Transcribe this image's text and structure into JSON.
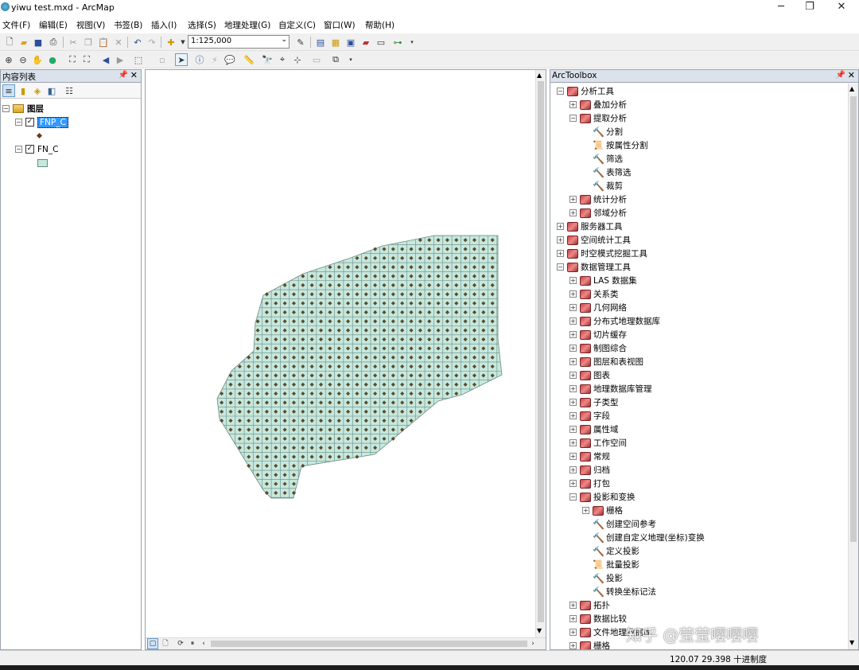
{
  "window": {
    "title": "yiwu test.mxd - ArcMap",
    "minimize": "─",
    "maximize": "❐",
    "close": "✕"
  },
  "menu": [
    "文件(F)",
    "编辑(E)",
    "视图(V)",
    "书签(B)",
    "插入(I)",
    "选择(S)",
    "地理处理(G)",
    "自定义(C)",
    "窗口(W)",
    "帮助(H)"
  ],
  "toolbar": {
    "scale": "1:125,000"
  },
  "toc": {
    "title": "内容列表",
    "root_label": "图层",
    "layers": [
      {
        "name": "FNP_C",
        "checked": true,
        "selected": true
      },
      {
        "name": "FN_C",
        "checked": true,
        "selected": false
      }
    ]
  },
  "arctoolbox": {
    "title": "ArcToolbox",
    "items": [
      {
        "label": "分析工具",
        "level": 0,
        "type": "toolbox",
        "expander": "−"
      },
      {
        "label": "叠加分析",
        "level": 1,
        "type": "toolset",
        "expander": "+"
      },
      {
        "label": "提取分析",
        "level": 1,
        "type": "toolset",
        "expander": "−"
      },
      {
        "label": "分割",
        "level": 2,
        "type": "tool"
      },
      {
        "label": "按属性分割",
        "level": 2,
        "type": "script"
      },
      {
        "label": "筛选",
        "level": 2,
        "type": "tool"
      },
      {
        "label": "表筛选",
        "level": 2,
        "type": "tool"
      },
      {
        "label": "裁剪",
        "level": 2,
        "type": "tool"
      },
      {
        "label": "统计分析",
        "level": 1,
        "type": "toolset",
        "expander": "+"
      },
      {
        "label": "邻域分析",
        "level": 1,
        "type": "toolset",
        "expander": "+"
      },
      {
        "label": "服务器工具",
        "level": 0,
        "type": "toolbox",
        "expander": "+"
      },
      {
        "label": "空间统计工具",
        "level": 0,
        "type": "toolbox",
        "expander": "+"
      },
      {
        "label": "时空模式挖掘工具",
        "level": 0,
        "type": "toolbox",
        "expander": "+"
      },
      {
        "label": "数据管理工具",
        "level": 0,
        "type": "toolbox",
        "expander": "−"
      },
      {
        "label": "LAS 数据集",
        "level": 1,
        "type": "toolset",
        "expander": "+"
      },
      {
        "label": "关系类",
        "level": 1,
        "type": "toolset",
        "expander": "+"
      },
      {
        "label": "几何网络",
        "level": 1,
        "type": "toolset",
        "expander": "+"
      },
      {
        "label": "分布式地理数据库",
        "level": 1,
        "type": "toolset",
        "expander": "+"
      },
      {
        "label": "切片缓存",
        "level": 1,
        "type": "toolset",
        "expander": "+"
      },
      {
        "label": "制图综合",
        "level": 1,
        "type": "toolset",
        "expander": "+"
      },
      {
        "label": "图层和表视图",
        "level": 1,
        "type": "toolset",
        "expander": "+"
      },
      {
        "label": "图表",
        "level": 1,
        "type": "toolset",
        "expander": "+"
      },
      {
        "label": "地理数据库管理",
        "level": 1,
        "type": "toolset",
        "expander": "+"
      },
      {
        "label": "子类型",
        "level": 1,
        "type": "toolset",
        "expander": "+"
      },
      {
        "label": "字段",
        "level": 1,
        "type": "toolset",
        "expander": "+"
      },
      {
        "label": "属性域",
        "level": 1,
        "type": "toolset",
        "expander": "+"
      },
      {
        "label": "工作空间",
        "level": 1,
        "type": "toolset",
        "expander": "+"
      },
      {
        "label": "常规",
        "level": 1,
        "type": "toolset",
        "expander": "+"
      },
      {
        "label": "归档",
        "level": 1,
        "type": "toolset",
        "expander": "+"
      },
      {
        "label": "打包",
        "level": 1,
        "type": "toolset",
        "expander": "+"
      },
      {
        "label": "投影和变换",
        "level": 1,
        "type": "toolset",
        "expander": "−"
      },
      {
        "label": "栅格",
        "level": 2,
        "type": "toolset",
        "expander": "+"
      },
      {
        "label": "创建空间参考",
        "level": 2,
        "type": "tool"
      },
      {
        "label": "创建自定义地理(坐标)变换",
        "level": 2,
        "type": "tool"
      },
      {
        "label": "定义投影",
        "level": 2,
        "type": "tool"
      },
      {
        "label": "批量投影",
        "level": 2,
        "type": "script"
      },
      {
        "label": "投影",
        "level": 2,
        "type": "tool"
      },
      {
        "label": "转换坐标记法",
        "level": 2,
        "type": "tool"
      },
      {
        "label": "拓扑",
        "level": 1,
        "type": "toolset",
        "expander": "+"
      },
      {
        "label": "数据比较",
        "level": 1,
        "type": "toolset",
        "expander": "+"
      },
      {
        "label": "文件地理数据库",
        "level": 1,
        "type": "toolset",
        "expander": "+"
      },
      {
        "label": "栅格",
        "level": 1,
        "type": "toolset",
        "expander": "+"
      }
    ]
  },
  "status": {
    "coords": "120.07  29.398 十进制度"
  },
  "watermark": "知乎 @莹莹嘤嘤嘤",
  "colors": {
    "polygon_fill": "#c6e8de",
    "grid_line": "#6a8a80",
    "point": "#5a4a2a",
    "panel_head": "#dbe2ec",
    "selection": "#3399ff"
  }
}
